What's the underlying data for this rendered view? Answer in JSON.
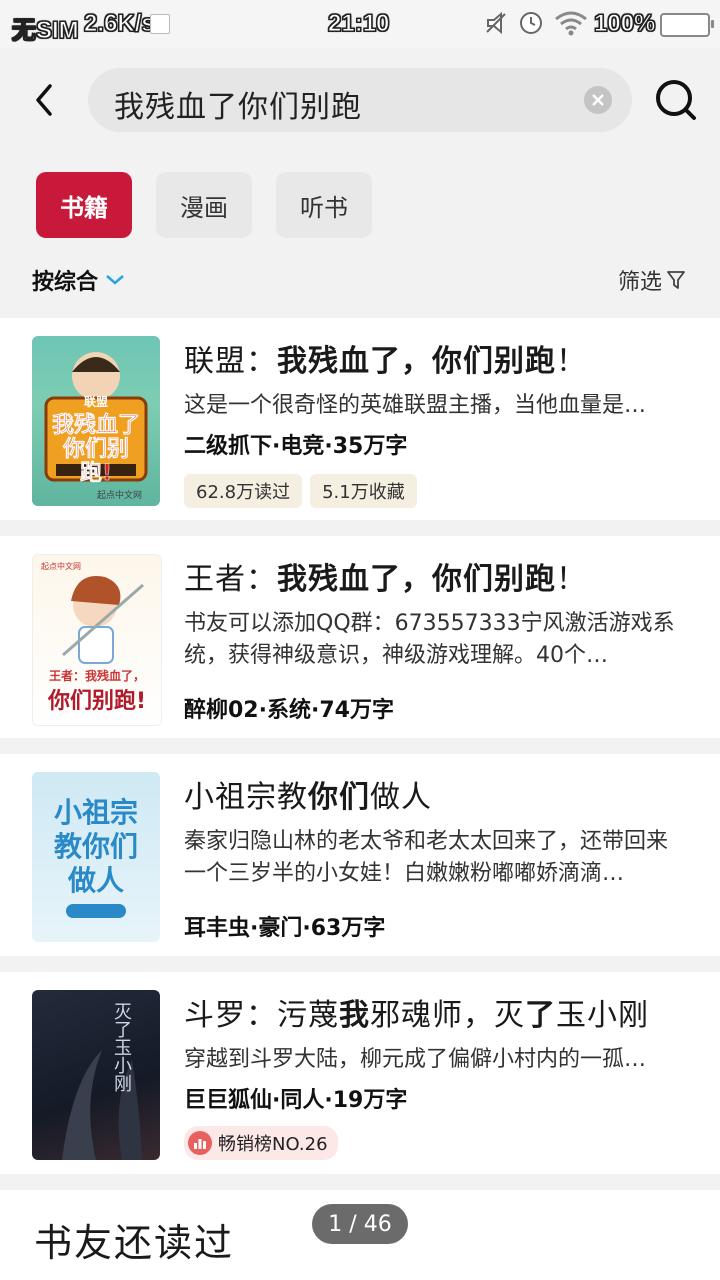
{
  "status_bar": {
    "carrier": "无SIM",
    "speed": "2.6K/s",
    "time": "21:10",
    "battery": "100%"
  },
  "search": {
    "query": "我残血了你们别跑"
  },
  "tabs": [
    {
      "label": "书籍",
      "active": true
    },
    {
      "label": "漫画",
      "active": false
    },
    {
      "label": "听书",
      "active": false
    }
  ],
  "sort": {
    "label": "按综合"
  },
  "filter": {
    "label": "筛选"
  },
  "books": [
    {
      "title_prefix": "联盟：",
      "title_highlight": "我残血了，你们别跑",
      "title_suffix": "！",
      "description": "这是一个很奇怪的英雄联盟主播，当他血量是…",
      "meta": "二级抓下·电竞·35万字",
      "tags": [
        "62.8万读过",
        "5.1万收藏"
      ]
    },
    {
      "title_prefix": "王者：",
      "title_highlight": "我残血了，你们别跑",
      "title_suffix": "！",
      "description": "书友可以添加QQ群：673557333宁风激活游戏系统，获得神级意识，神级游戏理解。40个…",
      "meta": "醉柳02·系统·74万字"
    },
    {
      "title_prefix": "小祖宗教",
      "title_highlight": "你们",
      "title_suffix": "做人",
      "description": "秦家归隐山林的老太爷和老太太回来了，还带回来一个三岁半的小女娃！白嫩嫩粉嘟嘟娇滴滴…",
      "meta": "耳丰虫·豪门·63万字"
    },
    {
      "title_prefix": "斗罗：污蔑",
      "title_highlight": "我",
      "title_middle": "邪魂师，灭",
      "title_highlight2": "了",
      "title_suffix": "玉小刚",
      "description": "穿越到斗罗大陆，柳元成了偏僻小村内的一孤…",
      "meta": "巨巨狐仙·同人·19万字",
      "rank": "畅销榜NO.26"
    }
  ],
  "section": {
    "title": "书友还读过"
  },
  "pager": {
    "label": "1 / 46"
  },
  "covers": {
    "book1": {
      "title": "我残血了你们别跑!",
      "badge": "联盟"
    },
    "book2": {
      "title": "你们别跑!",
      "subtitle": "王者：我残血了，"
    },
    "book3": {
      "title": "小祖宗教你们做人"
    },
    "book4": {
      "title": "灭了玉小刚"
    }
  }
}
